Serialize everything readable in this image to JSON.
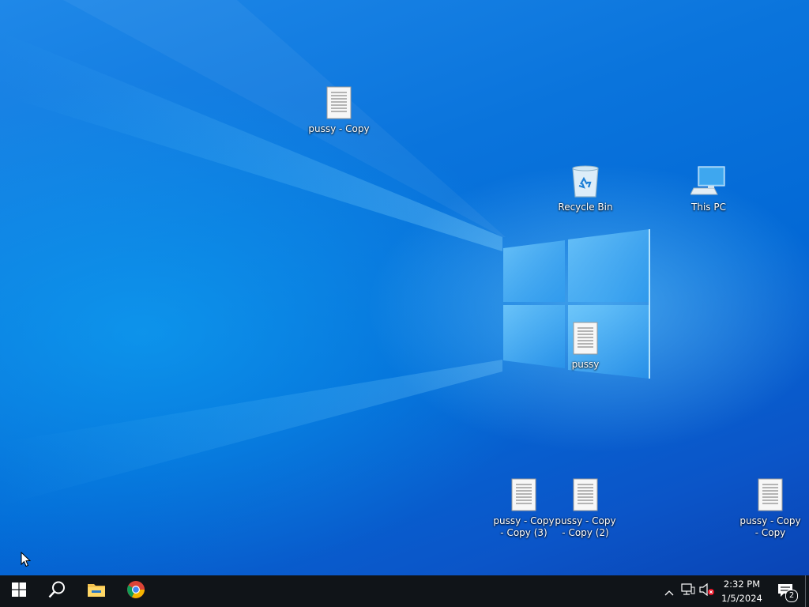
{
  "desktop": {
    "icons": [
      {
        "label": "pussy - Copy",
        "type": "text-file-icon"
      },
      {
        "label": "Recycle Bin",
        "type": "recycle-bin-icon"
      },
      {
        "label": "This PC",
        "type": "this-pc-icon"
      },
      {
        "label": "pussy",
        "type": "text-file-icon"
      },
      {
        "label": "pussy - Copy - Copy (3)",
        "type": "text-file-icon"
      },
      {
        "label": "pussy - Copy - Copy (2)",
        "type": "text-file-icon"
      },
      {
        "label": "pussy - Copy - Copy",
        "type": "text-file-icon"
      }
    ]
  },
  "taskbar": {
    "start_icon": "windows-start-icon",
    "search_icon": "search-icon",
    "pinned": [
      "file-explorer-icon",
      "chrome-icon"
    ],
    "tray": {
      "icons": [
        "show-hidden-icons-chevron",
        "network-icon",
        "volume-muted-icon"
      ],
      "time": "2:32 PM",
      "date": "1/5/2024",
      "notifications_count": "2"
    }
  },
  "colors": {
    "desktop_blue": "#0a74dc",
    "taskbar": "#101418"
  }
}
